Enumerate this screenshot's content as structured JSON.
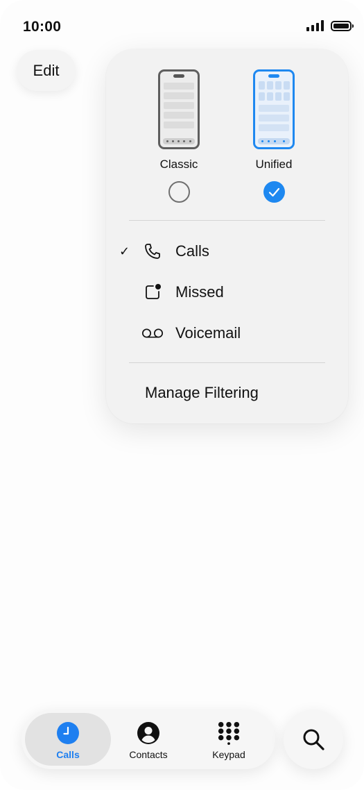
{
  "status_bar": {
    "time": "10:00",
    "signal_icon": "cellular-signal-icon",
    "battery_icon": "battery-icon"
  },
  "header": {
    "edit_label": "Edit"
  },
  "menu": {
    "layouts": [
      {
        "label": "Classic",
        "selected": false
      },
      {
        "label": "Unified",
        "selected": true
      }
    ],
    "filters": [
      {
        "label": "Calls",
        "icon": "phone-icon",
        "checked": true
      },
      {
        "label": "Missed",
        "icon": "missed-badge-icon",
        "checked": false
      },
      {
        "label": "Voicemail",
        "icon": "voicemail-icon",
        "checked": false
      }
    ],
    "check_mark": "✓",
    "manage_label": "Manage Filtering"
  },
  "tabbar": {
    "tabs": [
      {
        "label": "Calls",
        "icon": "clock-icon",
        "active": true
      },
      {
        "label": "Contacts",
        "icon": "person-circle-icon",
        "active": false
      },
      {
        "label": "Keypad",
        "icon": "keypad-icon",
        "active": false
      }
    ],
    "search_icon": "search-icon"
  },
  "colors": {
    "accent": "#1e88f0",
    "menu_bg": "#f2f2f2",
    "tab_active_bg": "#e2e2e2"
  }
}
